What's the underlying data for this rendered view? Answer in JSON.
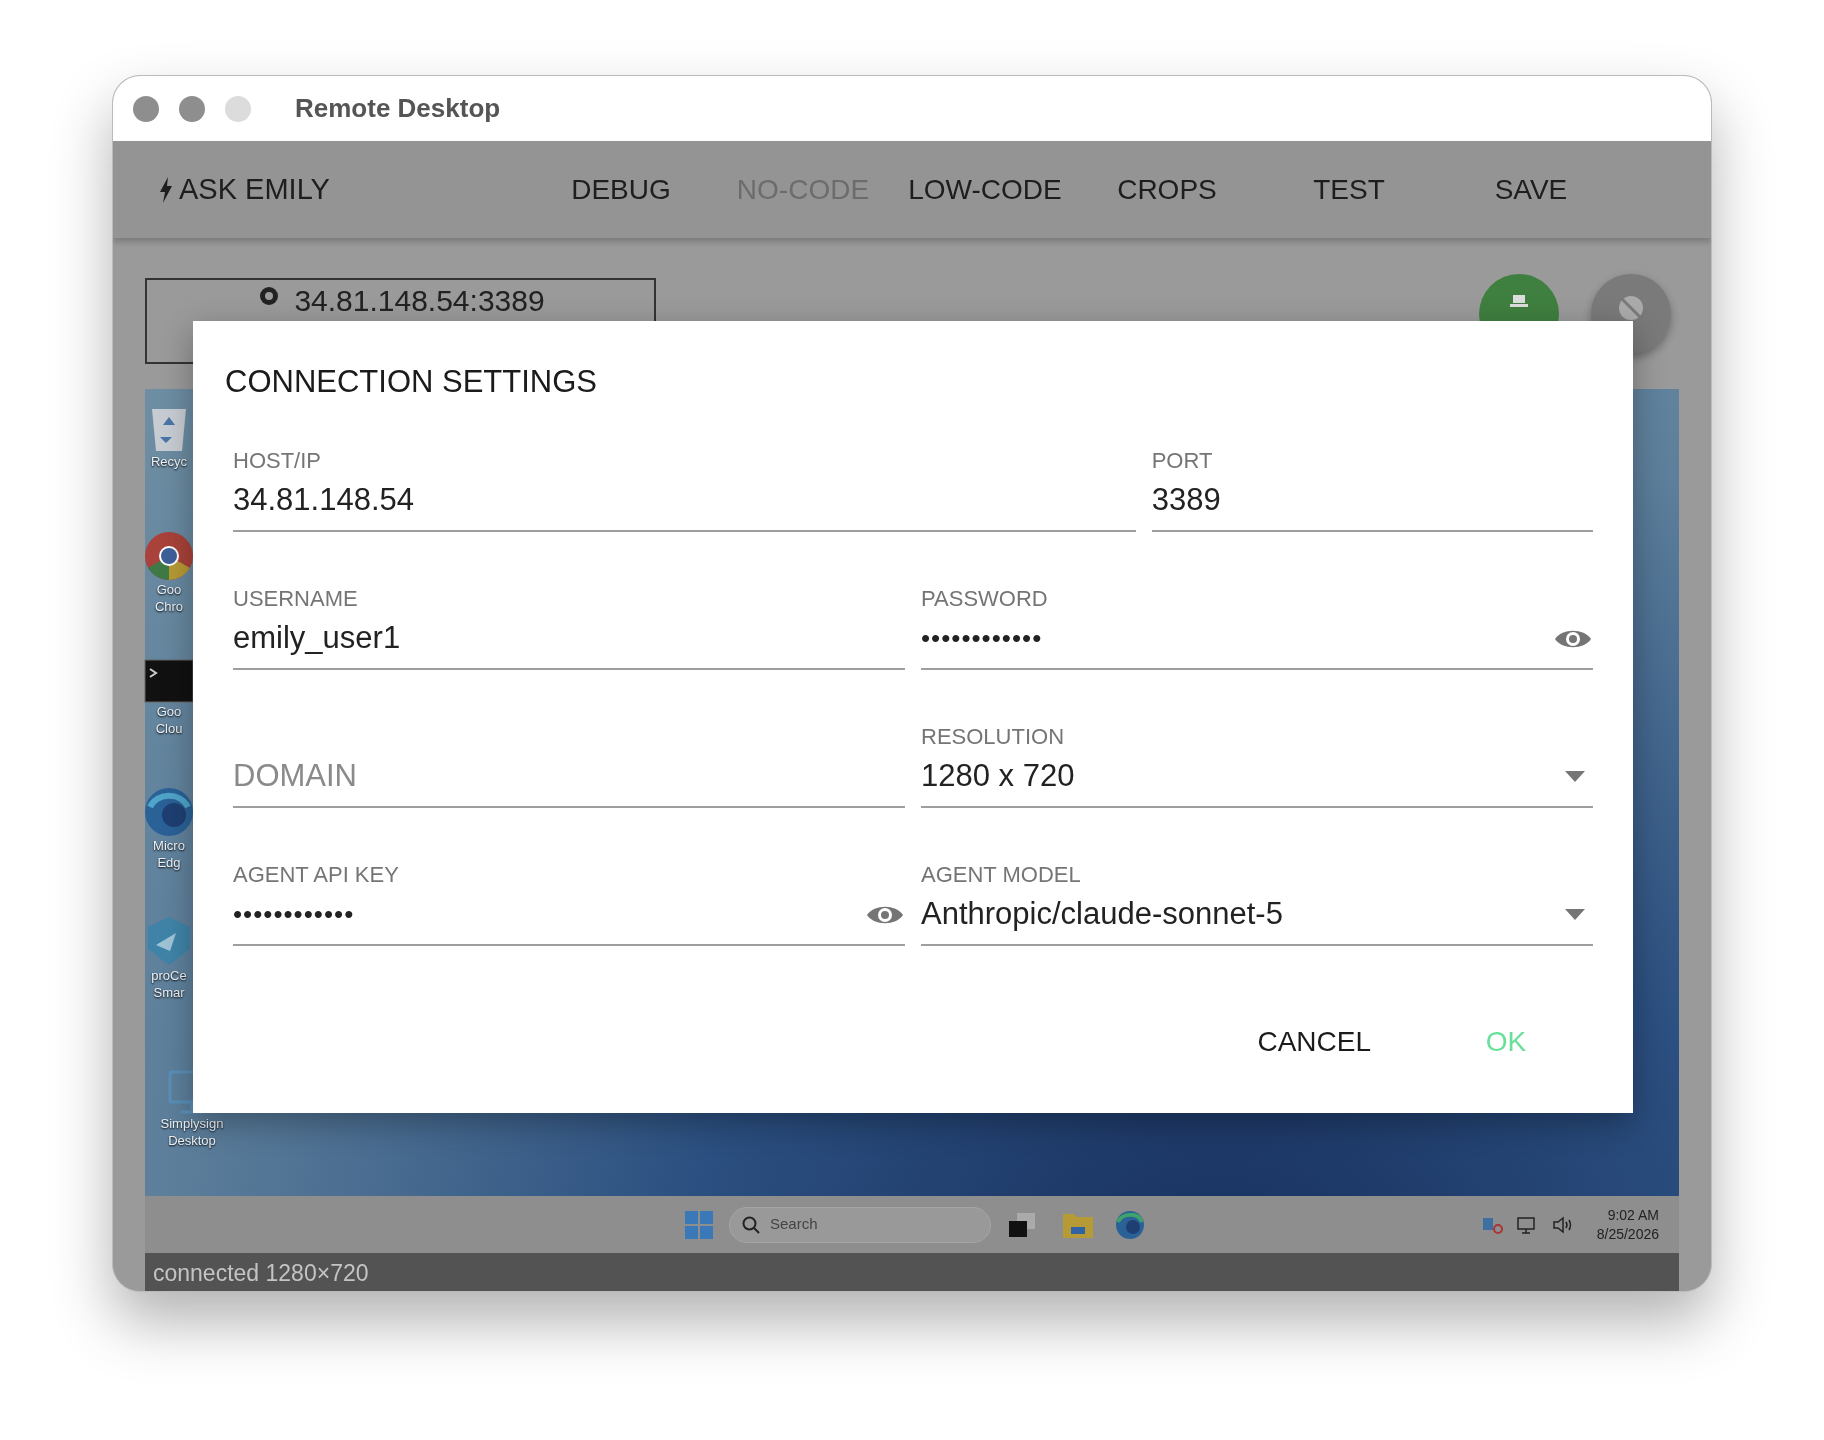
{
  "window": {
    "title": "Remote Desktop"
  },
  "toolbar": {
    "brand": "ASK EMILY",
    "items": [
      {
        "label": "DEBUG",
        "disabled": false
      },
      {
        "label": "NO-CODE",
        "disabled": true
      },
      {
        "label": "LOW-CODE",
        "disabled": false
      },
      {
        "label": "CROPS",
        "disabled": false
      },
      {
        "label": "TEST",
        "disabled": false
      },
      {
        "label": "SAVE",
        "disabled": false
      }
    ]
  },
  "connection_button": {
    "label": "34.81.148.54:3389"
  },
  "desktop": {
    "icons": [
      {
        "kind": "bin",
        "lines": [
          "Recyc"
        ]
      },
      {
        "kind": "chrome",
        "lines": [
          "Goo",
          "Chro"
        ]
      },
      {
        "kind": "terminal",
        "lines": [
          "Goo",
          "Clou"
        ]
      },
      {
        "kind": "edge",
        "lines": [
          "Micro",
          "Edg"
        ]
      },
      {
        "kind": "shield",
        "lines": [
          "proCe",
          "Smar"
        ]
      },
      {
        "kind": "monitor",
        "lines": [
          "Simplysign",
          "Desktop"
        ]
      }
    ]
  },
  "taskbar": {
    "search_placeholder": "Search",
    "time": "9:02 AM",
    "date": "8/25/2026"
  },
  "status_bar": {
    "text": "connected 1280×720"
  },
  "dialog": {
    "title": "CONNECTION SETTINGS",
    "rows": [
      [
        {
          "kind": "text",
          "label": "HOST/IP",
          "value": "34.81.148.54"
        },
        {
          "kind": "text",
          "label": "PORT",
          "value": "3389"
        }
      ],
      [
        {
          "kind": "text",
          "label": "USERNAME",
          "value": "emily_user1"
        },
        {
          "kind": "password",
          "label": "PASSWORD",
          "value": "••••••••••••"
        }
      ],
      [
        {
          "kind": "text",
          "placeholder": "DOMAIN"
        },
        {
          "kind": "select",
          "label": "RESOLUTION",
          "value": "1280 x 720"
        }
      ],
      [
        {
          "kind": "password",
          "label": "AGENT API KEY",
          "value": "••••••••••••"
        },
        {
          "kind": "select",
          "label": "AGENT MODEL",
          "value": "Anthropic/claude-sonnet-5"
        }
      ]
    ],
    "buttons": [
      {
        "kind": "secondary",
        "label": "CANCEL"
      },
      {
        "kind": "primary",
        "label": "OK"
      }
    ]
  }
}
